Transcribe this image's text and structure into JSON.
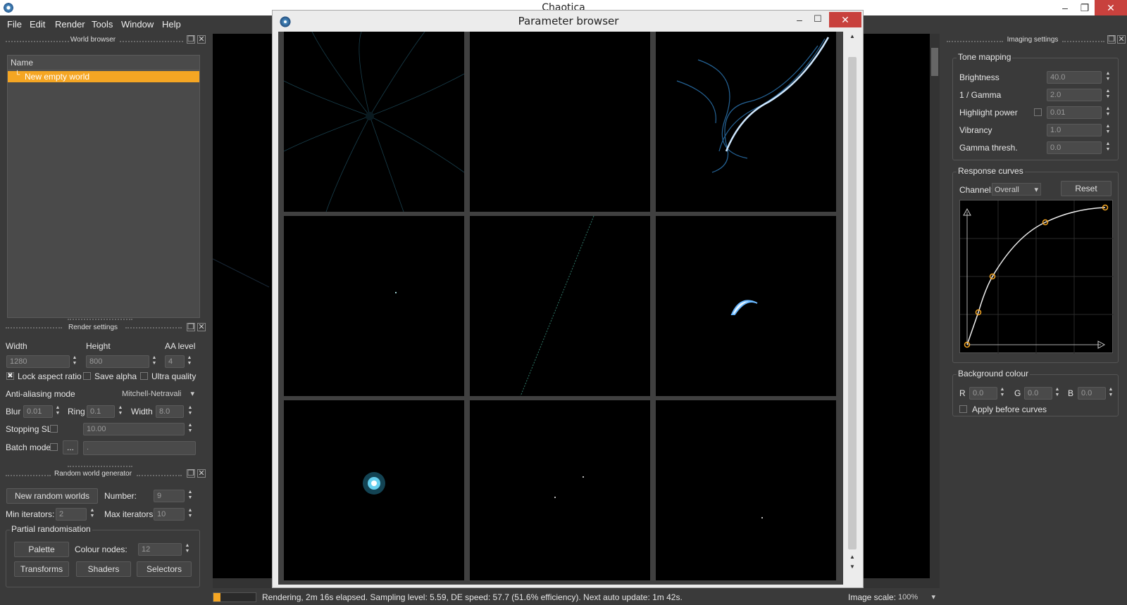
{
  "app": {
    "title": "Chaotica"
  },
  "menu": {
    "file": "File",
    "edit": "Edit",
    "render": "Render",
    "tools": "Tools",
    "window": "Window",
    "help": "Help"
  },
  "world_browser": {
    "title": "World browser",
    "column_name": "Name",
    "items": [
      {
        "label": "New empty world"
      }
    ]
  },
  "render_settings": {
    "title": "Render settings",
    "width_label": "Width",
    "width_value": "1280",
    "height_label": "Height",
    "height_value": "800",
    "aa_label": "AA level",
    "aa_value": "4",
    "lock_aspect": "Lock aspect ratio",
    "lock_aspect_checked": "✖",
    "save_alpha": "Save alpha",
    "ultra_quality": "Ultra quality",
    "aa_mode_label": "Anti-aliasing mode",
    "aa_mode_value": "Mitchell-Netravali",
    "blur_label": "Blur",
    "blur_value": "0.01",
    "ring_label": "Ring",
    "ring_value": "0.1",
    "filter_width_label": "Width",
    "filter_width_value": "8.0",
    "stopping_label": "Stopping SL",
    "stopping_value": "10.00",
    "batch_label": "Batch mode",
    "batch_browse": "...",
    "batch_value": "."
  },
  "random_gen": {
    "title": "Random world generator",
    "new_button": "New random worlds",
    "number_label": "Number:",
    "number_value": "9",
    "min_label": "Min iterators:",
    "min_value": "2",
    "max_label": "Max iterators:",
    "max_value": "10",
    "partial_title": "Partial randomisation",
    "palette_button": "Palette",
    "colour_nodes_label": "Colour nodes:",
    "colour_nodes_value": "12",
    "transforms_button": "Transforms",
    "shaders_button": "Shaders",
    "selectors_button": "Selectors"
  },
  "param_browser": {
    "title": "Parameter browser"
  },
  "imaging": {
    "title": "Imaging settings",
    "tone_title": "Tone mapping",
    "brightness_label": "Brightness",
    "brightness_value": "40.0",
    "gamma_label": "1 / Gamma",
    "gamma_value": "2.0",
    "highlight_label": "Highlight power",
    "highlight_value": "0.01",
    "vibrancy_label": "Vibrancy",
    "vibrancy_value": "1.0",
    "gamma_thresh_label": "Gamma thresh.",
    "gamma_thresh_value": "0.0",
    "curves_title": "Response curves",
    "channel_label": "Channel:",
    "channel_value": "Overall",
    "reset_button": "Reset",
    "bg_title": "Background colour",
    "r_label": "R",
    "r_value": "0.0",
    "g_label": "G",
    "g_value": "0.0",
    "b_label": "B",
    "b_value": "0.0",
    "apply_label": "Apply before curves"
  },
  "status": {
    "text": "Rendering, 2m 16s elapsed. Sampling level: 5.59, DE speed: 57.7 (51.6% efficiency). Next auto update: 1m 42s.",
    "scale_label": "Image scale:",
    "scale_value": "100%"
  },
  "colors": {
    "accent": "#f5a623",
    "panel": "#3a3a3a",
    "curve_node": "#f5a623"
  }
}
